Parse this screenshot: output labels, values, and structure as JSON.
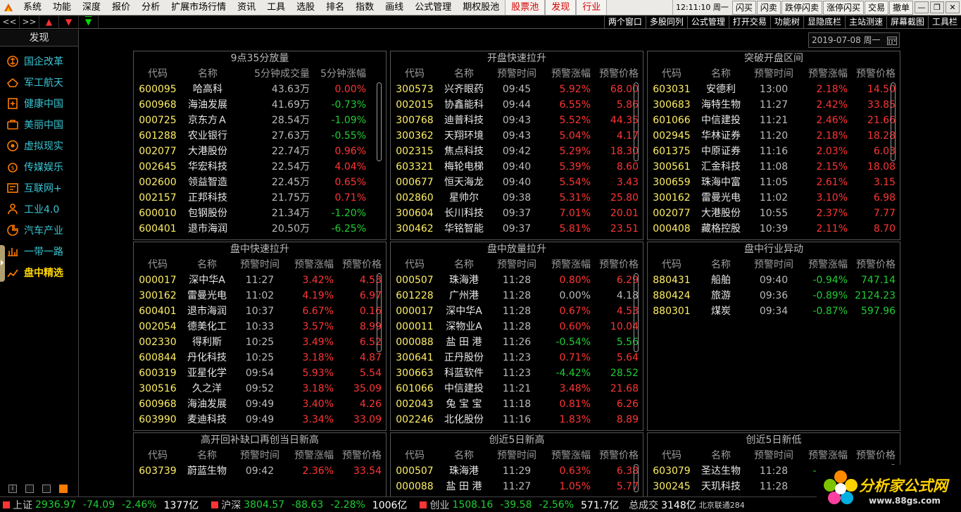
{
  "menu": {
    "items": [
      "系统",
      "功能",
      "深度",
      "报价",
      "分析",
      "扩展市场行情",
      "资讯",
      "工具",
      "选股",
      "排名",
      "指数",
      "画线",
      "公式管理",
      "期权股池"
    ],
    "highlight": [
      "股票池",
      "发现",
      "行业"
    ],
    "clock": "12:11:10 周一",
    "right_buttons": [
      "闪买",
      "闪卖",
      "跌停闪卖",
      "涨停闪买",
      "交易",
      "撤单"
    ]
  },
  "toolbar": {
    "nav": [
      "<<",
      ">>"
    ],
    "right": [
      "两个窗口",
      "多股同列",
      "公式管理",
      "打开交易",
      "功能树",
      "显隐底栏",
      "主站测速",
      "屏幕截图",
      "工具栏"
    ]
  },
  "sidebar": {
    "title": "发现",
    "items": [
      "国企改革",
      "军工航天",
      "健康中国",
      "美丽中国",
      "虚拟现实",
      "传媒娱乐",
      "互联网+",
      "工业4.0",
      "汽车产业",
      "一带一路",
      "盘中精选"
    ],
    "active_index": 10
  },
  "date": "2019-07-08 周一",
  "panels": [
    {
      "title": "9点35分放量",
      "headers": [
        "代码",
        "名称",
        "5分钟成交量",
        "5分钟涨幅"
      ],
      "rows": [
        [
          "600095",
          "哈高科",
          "43.63万",
          "0.00%"
        ],
        [
          "600968",
          "海油发展",
          "41.69万",
          "-0.73%"
        ],
        [
          "000725",
          "京东方Ａ",
          "28.54万",
          "-1.09%"
        ],
        [
          "601288",
          "农业银行",
          "27.63万",
          "-0.55%"
        ],
        [
          "002077",
          "大港股份",
          "22.74万",
          "0.96%"
        ],
        [
          "002645",
          "华宏科技",
          "22.54万",
          "4.04%"
        ],
        [
          "002600",
          "领益智造",
          "22.45万",
          "0.65%"
        ],
        [
          "002157",
          "正邦科技",
          "21.75万",
          "0.71%"
        ],
        [
          "600010",
          "包钢股份",
          "21.34万",
          "-1.20%"
        ],
        [
          "600401",
          "退市海润",
          "20.50万",
          "-6.25%"
        ]
      ]
    },
    {
      "title": "开盘快速拉升",
      "headers": [
        "代码",
        "名称",
        "预警时间",
        "预警涨幅",
        "预警价格"
      ],
      "rows": [
        [
          "300573",
          "兴齐眼药",
          "09:45",
          "5.92%",
          "68.00"
        ],
        [
          "002015",
          "协鑫能科",
          "09:44",
          "6.55%",
          "5.86"
        ],
        [
          "300768",
          "迪普科技",
          "09:43",
          "5.52%",
          "44.35"
        ],
        [
          "300362",
          "天翔环境",
          "09:43",
          "5.04%",
          "4.17"
        ],
        [
          "002315",
          "焦点科技",
          "09:42",
          "5.29%",
          "18.30"
        ],
        [
          "603321",
          "梅轮电梯",
          "09:40",
          "5.39%",
          "8.60"
        ],
        [
          "000677",
          "恒天海龙",
          "09:40",
          "5.54%",
          "3.43"
        ],
        [
          "002860",
          "星帅尔",
          "09:38",
          "5.31%",
          "25.80"
        ],
        [
          "300604",
          "长川科技",
          "09:37",
          "7.01%",
          "20.01"
        ],
        [
          "300462",
          "华铭智能",
          "09:37",
          "5.81%",
          "23.51"
        ]
      ]
    },
    {
      "title": "突破开盘区间",
      "headers": [
        "代码",
        "名称",
        "预警时间",
        "预警涨幅",
        "预警价格"
      ],
      "rows": [
        [
          "603031",
          "安德利",
          "13:00",
          "2.18%",
          "14.50"
        ],
        [
          "300683",
          "海特生物",
          "11:27",
          "2.42%",
          "33.85"
        ],
        [
          "601066",
          "中信建投",
          "11:21",
          "2.46%",
          "21.66"
        ],
        [
          "002945",
          "华林证券",
          "11:20",
          "2.18%",
          "18.28"
        ],
        [
          "601375",
          "中原证券",
          "11:16",
          "2.03%",
          "6.03"
        ],
        [
          "300561",
          "汇金科技",
          "11:08",
          "2.15%",
          "18.08"
        ],
        [
          "300659",
          "珠海中富",
          "11:05",
          "2.61%",
          "3.15"
        ],
        [
          "300162",
          "雷曼光电",
          "11:02",
          "3.10%",
          "6.98"
        ],
        [
          "002077",
          "大港股份",
          "10:55",
          "2.37%",
          "7.77"
        ],
        [
          "000408",
          "藏格控股",
          "10:39",
          "2.11%",
          "8.70"
        ]
      ]
    },
    {
      "title": "盘中快速拉升",
      "headers": [
        "代码",
        "名称",
        "预警时间",
        "预警涨幅",
        "预警价格"
      ],
      "rows": [
        [
          "000017",
          "深中华A",
          "11:27",
          "3.42%",
          "4.53"
        ],
        [
          "300162",
          "雷曼光电",
          "11:02",
          "4.19%",
          "6.97"
        ],
        [
          "600401",
          "退市海润",
          "10:37",
          "6.67%",
          "0.16"
        ],
        [
          "002054",
          "德美化工",
          "10:33",
          "3.57%",
          "8.99"
        ],
        [
          "002330",
          "得利斯",
          "10:25",
          "3.49%",
          "6.52"
        ],
        [
          "600844",
          "丹化科技",
          "10:25",
          "3.18%",
          "4.87"
        ],
        [
          "600319",
          "亚星化学",
          "09:54",
          "5.93%",
          "5.54"
        ],
        [
          "300516",
          "久之洋",
          "09:52",
          "3.18%",
          "35.09"
        ],
        [
          "600968",
          "海油发展",
          "09:49",
          "3.40%",
          "4.26"
        ],
        [
          "603990",
          "麦迪科技",
          "09:49",
          "3.34%",
          "33.09"
        ]
      ]
    },
    {
      "title": "盘中放量拉升",
      "headers": [
        "代码",
        "名称",
        "预警时间",
        "预警涨幅",
        "预警价格"
      ],
      "rows": [
        [
          "000507",
          "珠海港",
          "11:28",
          "0.80%",
          "6.29"
        ],
        [
          "601228",
          "广州港",
          "11:28",
          "0.00%",
          "4.18"
        ],
        [
          "000017",
          "深中华A",
          "11:28",
          "0.67%",
          "4.53"
        ],
        [
          "000011",
          "深物业A",
          "11:28",
          "0.60%",
          "10.04"
        ],
        [
          "000088",
          "盐 田 港",
          "11:26",
          "-0.54%",
          "5.56"
        ],
        [
          "300641",
          "正丹股份",
          "11:23",
          "0.71%",
          "5.64"
        ],
        [
          "300663",
          "科蓝软件",
          "11:23",
          "-4.42%",
          "28.52"
        ],
        [
          "601066",
          "中信建投",
          "11:21",
          "3.48%",
          "21.68"
        ],
        [
          "002043",
          "兔 宝 宝",
          "11:18",
          "0.81%",
          "6.26"
        ],
        [
          "002246",
          "北化股份",
          "11:16",
          "1.83%",
          "8.89"
        ]
      ]
    },
    {
      "title": "盘中行业异动",
      "headers": [
        "代码",
        "名称",
        "预警时间",
        "预警涨幅",
        "预警价格"
      ],
      "rows": [
        [
          "880431",
          "船舶",
          "09:40",
          "-0.94%",
          "747.14"
        ],
        [
          "880424",
          "旅游",
          "09:36",
          "-0.89%",
          "2124.23"
        ],
        [
          "880301",
          "煤炭",
          "09:34",
          "-0.87%",
          "597.96"
        ]
      ]
    },
    {
      "title": "高开回补缺口再创当日新高",
      "headers": [
        "代码",
        "名称",
        "预警时间",
        "预警涨幅",
        "预警价格"
      ],
      "rows": [
        [
          "603739",
          "蔚蓝生物",
          "09:42",
          "2.36%",
          "33.54"
        ]
      ]
    },
    {
      "title": "创近5日新高",
      "headers": [
        "代码",
        "名称",
        "预警时间",
        "预警涨幅",
        "预警价格"
      ],
      "rows": [
        [
          "000507",
          "珠海港",
          "11:29",
          "0.63%",
          "6.38"
        ],
        [
          "000088",
          "盐 田 港",
          "11:27",
          "1.05%",
          "5.77"
        ]
      ]
    },
    {
      "title": "创近5日新低",
      "headers": [
        "代码",
        "名称",
        "预警时间",
        "预警涨幅",
        "预警价格"
      ],
      "rows": [
        [
          "603079",
          "圣达生物",
          "11:28",
          "-1.14%",
          "28.67"
        ],
        [
          "300245",
          "天玑科技",
          "11:28",
          "-0.",
          "5"
        ]
      ]
    }
  ],
  "status": {
    "indices": [
      {
        "name": "上证",
        "value": "2936.97",
        "change": "-74.09",
        "pct": "-2.46%",
        "amount": "1377亿"
      },
      {
        "name": "沪深",
        "value": "3804.57",
        "change": "-88.63",
        "pct": "-2.28%",
        "amount": "1006亿"
      },
      {
        "name": "创业",
        "value": "1508.16",
        "change": "-39.58",
        "pct": "-2.56%",
        "amount": "571.7亿"
      }
    ],
    "total_label": "总成交",
    "total_value": "3148亿",
    "network": "北京联通284"
  },
  "brand": {
    "name": "分析家公式网",
    "url": "www.88gs.com"
  },
  "colors": {
    "up": "#ff3535",
    "down": "#22cc33",
    "code": "#ffef66",
    "accent": "#39c6d4",
    "active": "#ffd700"
  }
}
